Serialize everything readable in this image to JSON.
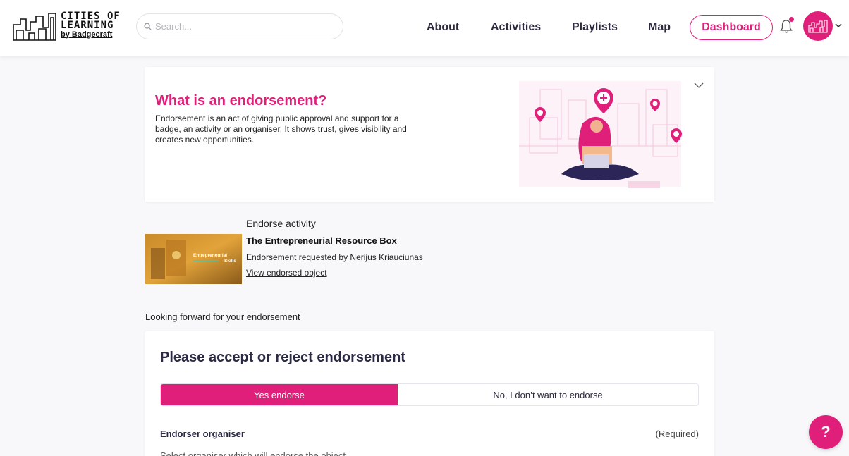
{
  "header": {
    "logo_line1": "CITIES OF",
    "logo_line2": "LEARNING",
    "logo_line3": "by Badgecraft",
    "search_placeholder": "Search...",
    "nav": {
      "about": "About",
      "activities": "Activities",
      "playlists": "Playlists",
      "map": "Map",
      "dashboard": "Dashboard"
    }
  },
  "info": {
    "title": "What is an endorsement?",
    "text": "Endorsement is an act of giving public approval and support for a badge, an activity or an organiser. It shows trust, gives visibility and creates new opportunities."
  },
  "activity": {
    "label": "Endorse activity",
    "thumb_line1": "Entrepreneurial",
    "thumb_line2": "Skills",
    "name": "The Entrepreneurial Resource Box",
    "requested": "Endorsement requested by Nerijus Kriauciunas",
    "view_link": "View endorsed object"
  },
  "looking": "Looking forward for your endorsement",
  "form": {
    "title": "Please accept or reject endorsement",
    "yes": "Yes endorse",
    "no": "No, I don’t want to endorse",
    "org_label": "Endorser organiser",
    "required": "(Required)",
    "org_desc": "Select organiser which will endorse the object"
  },
  "help": "?",
  "colors": {
    "accent": "#e01f7a"
  }
}
